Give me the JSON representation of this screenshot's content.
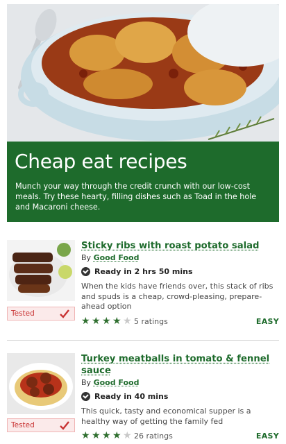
{
  "colors": {
    "brand_green": "#1e6b2c",
    "star_on": "#2f6f2f",
    "star_off": "#c8c8c8",
    "tested_red": "#c83232"
  },
  "hero": {
    "image": "chicken-casserole-photo"
  },
  "banner": {
    "title": "Cheap eat recipes",
    "description": "Munch your way through the credit crunch with our low-cost meals. Try these hearty, filling dishes such as Toad in the hole and Macaroni cheese."
  },
  "recipes": [
    {
      "title": "Sticky ribs with roast potato salad",
      "by_prefix": "By ",
      "author": "Good Food",
      "ready": "Ready in 2 hrs 50 mins",
      "description": "When the kids have friends over, this stack of ribs and spuds is a cheap, crowd-pleasing, prepare-ahead option",
      "rating": 4,
      "rating_max": 5,
      "ratings_text": "5 ratings",
      "difficulty": "EASY",
      "tested_label": "Tested",
      "thumb": "ribs-photo"
    },
    {
      "title": "Turkey meatballs in tomato & fennel sauce",
      "by_prefix": "By ",
      "author": "Good Food",
      "ready": "Ready in 40 mins",
      "description": "This quick, tasty and economical supper is a healthy way of getting the family fed",
      "rating": 4,
      "rating_max": 5,
      "ratings_text": "26 ratings",
      "difficulty": "EASY",
      "tested_label": "Tested",
      "thumb": "meatballs-photo"
    }
  ]
}
